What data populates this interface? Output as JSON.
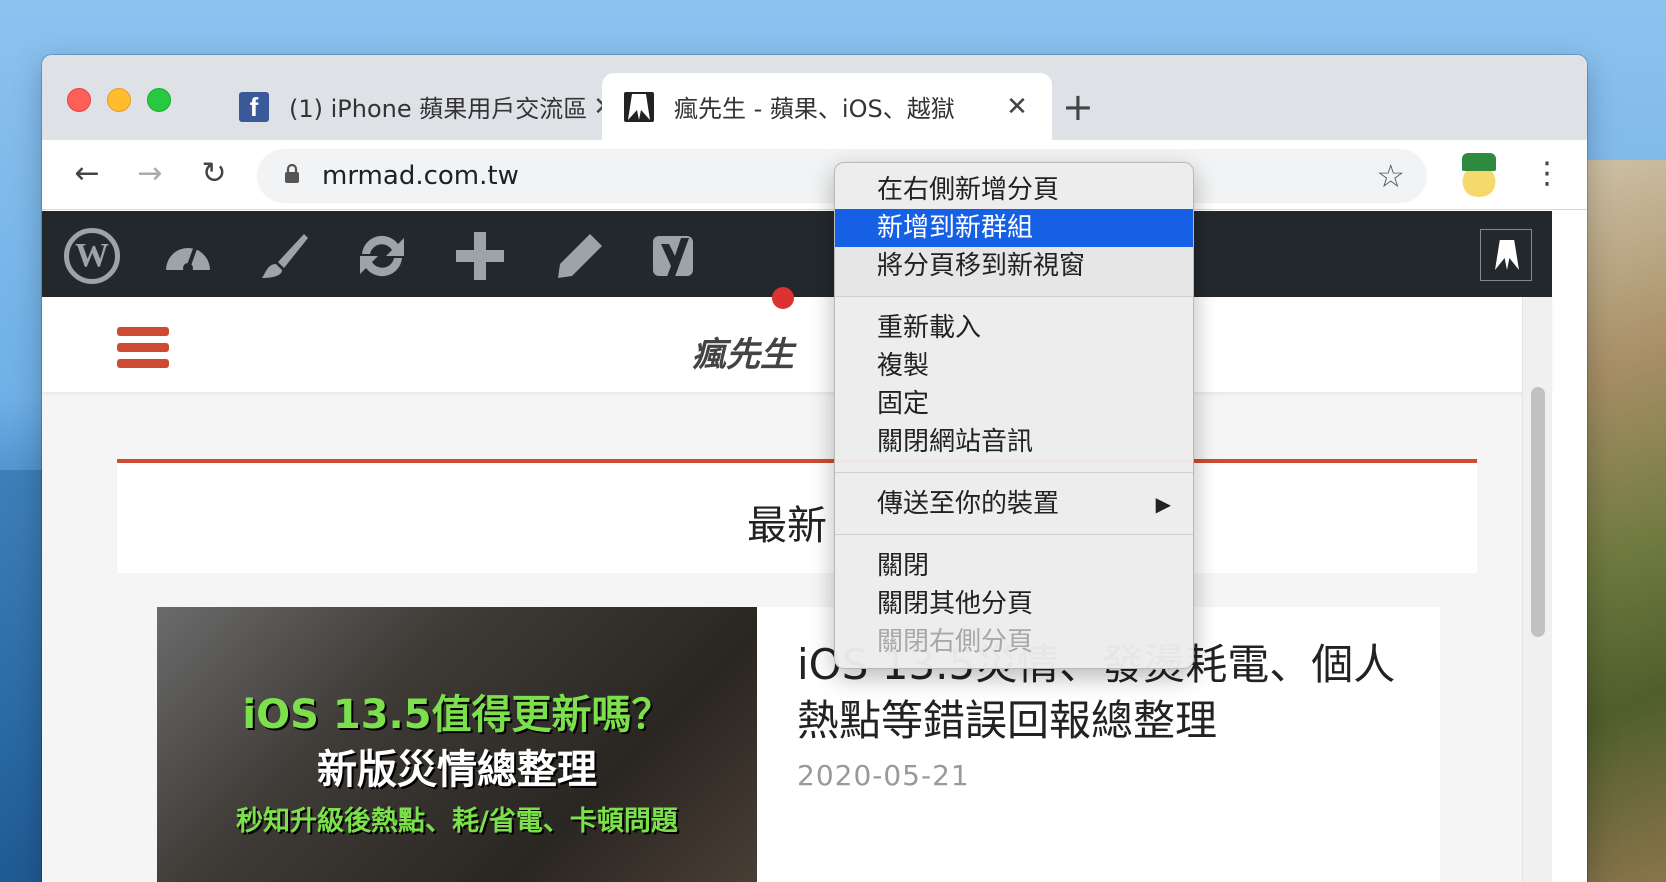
{
  "browser": {
    "tabs": [
      {
        "title": "(1) iPhone 蘋果用戶交流區",
        "favicon": "facebook-icon",
        "active": false
      },
      {
        "title": "瘋先生 - 蘋果、iOS、越獄",
        "favicon": "mrmad-icon",
        "active": true
      }
    ],
    "url": "mrmad.com.tw"
  },
  "context_menu": {
    "groups": [
      [
        {
          "label": "在右側新增分頁",
          "state": "normal"
        },
        {
          "label": "新增到新群組",
          "state": "highlighted"
        },
        {
          "label": "將分頁移到新視窗",
          "state": "normal"
        }
      ],
      [
        {
          "label": "重新載入",
          "state": "normal"
        },
        {
          "label": "複製",
          "state": "normal"
        },
        {
          "label": "固定",
          "state": "normal"
        },
        {
          "label": "關閉網站音訊",
          "state": "normal"
        }
      ],
      [
        {
          "label": "傳送至你的裝置",
          "state": "normal",
          "submenu": true
        }
      ],
      [
        {
          "label": "關閉",
          "state": "normal"
        },
        {
          "label": "關閉其他分頁",
          "state": "normal"
        },
        {
          "label": "關閉右側分頁",
          "state": "disabled"
        }
      ]
    ]
  },
  "site": {
    "logo_text": "瘋先生",
    "section_title": "最新",
    "post": {
      "thumb_line1": "iOS 13.5值得更新嗎？",
      "thumb_line2": "新版災情總整理",
      "thumb_line3": "秒知升級後熱點、耗/省電、卡頓問題",
      "title": "iOS 13.5災情、發燙耗電、個人熱點等錯誤回報總整理",
      "date": "2020-05-21"
    }
  },
  "colors": {
    "accent": "#cf4a32",
    "menu_highlight": "#1660e6",
    "admin_bar": "#23282d"
  }
}
